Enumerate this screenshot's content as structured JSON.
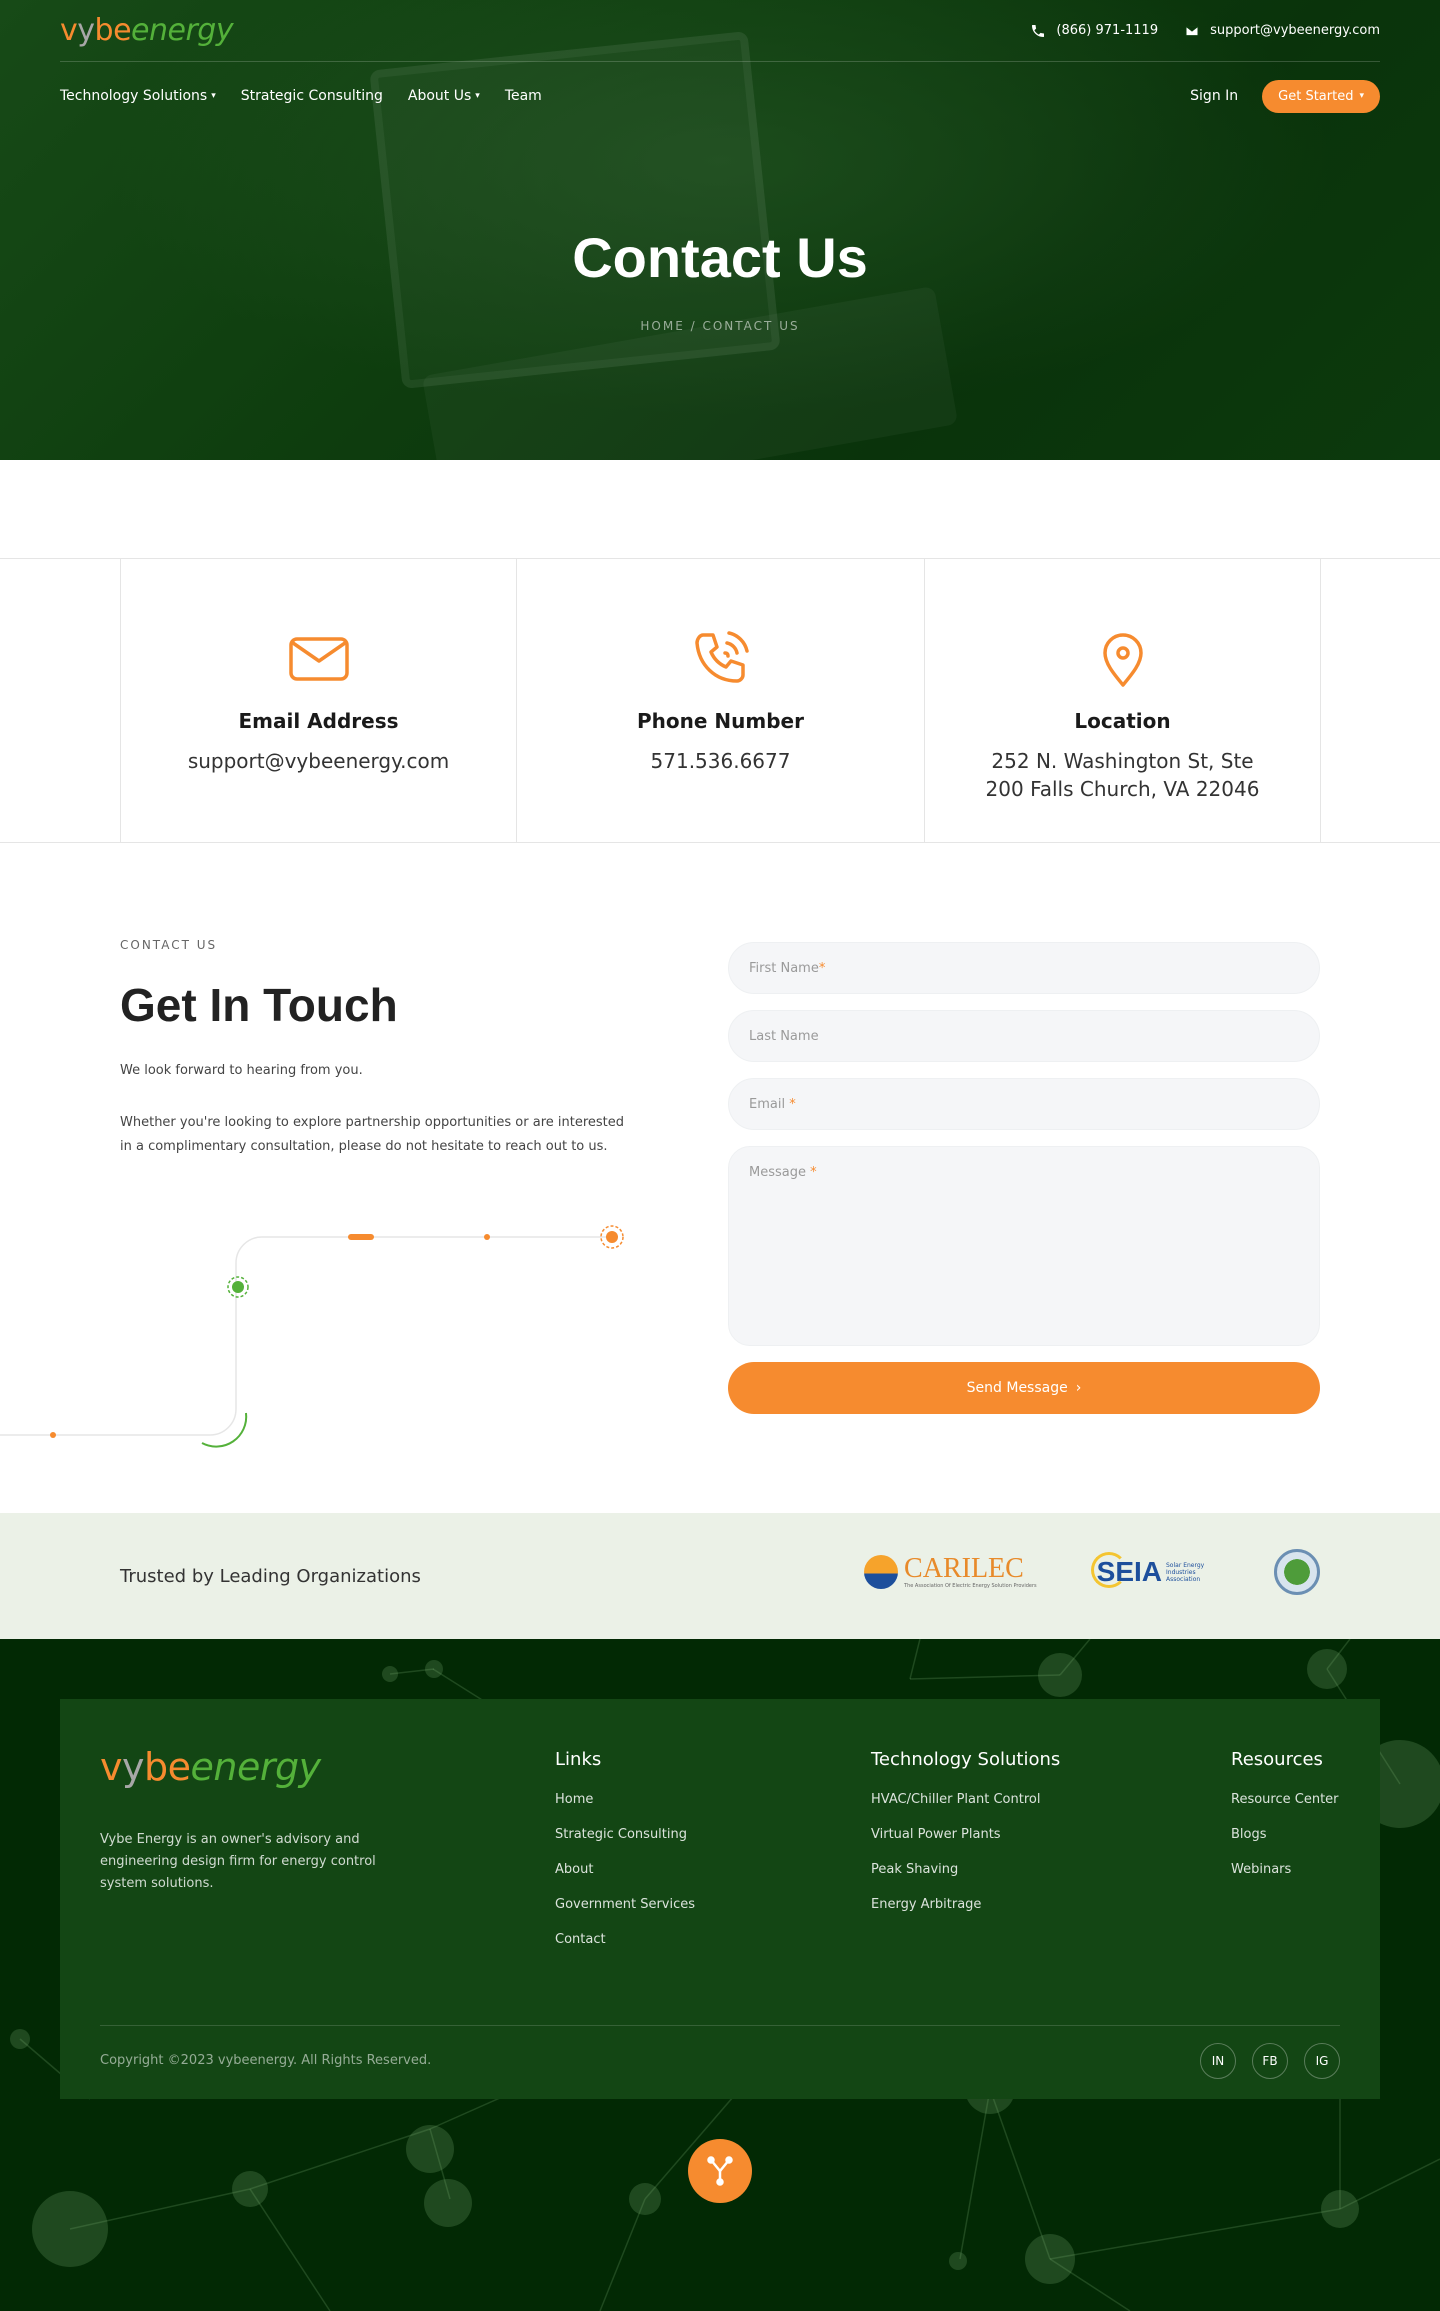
{
  "brand": {
    "logo_v": "v",
    "logo_y": "y",
    "logo_be": "be",
    "logo_energy": "energy"
  },
  "topbar": {
    "phone": "(866) 971-1119",
    "email": "support@vybeenergy.com"
  },
  "nav": {
    "items": [
      "Technology Solutions",
      "Strategic Consulting",
      "About Us",
      "Team"
    ],
    "sign_in": "Sign In",
    "cta": "Get Started"
  },
  "hero": {
    "title": "Contact Us",
    "breadcrumb": "HOME / CONTACT US"
  },
  "cards": [
    {
      "icon": "mail-icon",
      "title": "Email Address",
      "value": "support@vybeenergy.com"
    },
    {
      "icon": "phone-icon",
      "title": "Phone Number",
      "value": "571.536.6677"
    },
    {
      "icon": "location-pin-icon",
      "title": "Location",
      "value": "252 N. Washington St, Ste",
      "value2": "200 Falls Church, VA 22046"
    }
  ],
  "touch": {
    "eyebrow": "CONTACT US",
    "title": "Get In Touch",
    "p1": "We look forward to hearing from you.",
    "p2": "Whether you're looking to explore partnership opportunities or are interested in a complimentary consultation, please do not hesitate to reach out to us."
  },
  "form": {
    "first_name": "First Name",
    "last_name": "Last Name",
    "email": "Email",
    "message": "Message",
    "send": "Send Message"
  },
  "trusted": {
    "label": "Trusted by Leading Organizations",
    "carilec": "CARILEC",
    "carilec_sub": "The Association Of Electric Energy Solution Providers",
    "seia": "SEIA",
    "seia_sub": "Solar Energy Industries Association"
  },
  "footer": {
    "description": "Vybe Energy is an owner's advisory and engineering design firm for energy control system solutions.",
    "columns": [
      {
        "head": "Links",
        "items": [
          "Home",
          "Strategic Consulting",
          "About",
          "Government Services",
          "Contact"
        ]
      },
      {
        "head": "Technology Solutions",
        "items": [
          "HVAC/Chiller Plant Control",
          "Virtual Power Plants",
          "Peak Shaving",
          "Energy Arbitrage"
        ]
      },
      {
        "head": "Resources",
        "items": [
          "Resource Center",
          "Blogs",
          "Webinars"
        ]
      }
    ],
    "copyright": "Copyright ©2023 vybeenergy. All Rights Reserved.",
    "socials": [
      "IN",
      "FB",
      "IG"
    ]
  },
  "colors": {
    "accent": "#f68b2f",
    "brand_green": "#54b13a",
    "dark_green": "#022904"
  }
}
